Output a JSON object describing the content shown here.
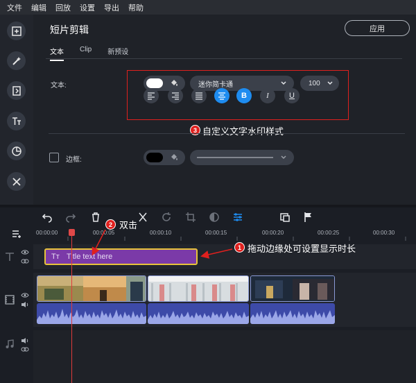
{
  "menu": [
    "文件",
    "编辑",
    "回放",
    "设置",
    "导出",
    "帮助"
  ],
  "rail_icons": [
    "import-icon",
    "magic-wand-icon",
    "transition-icon",
    "titles-icon",
    "stickers-icon",
    "tools-icon"
  ],
  "panel": {
    "title": "短片剪辑",
    "apply_label": "应用",
    "tabs": [
      "文本",
      "Clip",
      "新预设"
    ],
    "active_tab": "文本"
  },
  "text_settings": {
    "label": "文本:",
    "font": "迷你简卡通",
    "size": "100",
    "text_color": "#ffffff"
  },
  "border_settings": {
    "label": "边框:",
    "color": "#000000",
    "checked": false
  },
  "annotations": {
    "step1_number": "1",
    "step1_text": "拖动边缘处可设置显示时长",
    "step2_number": "2",
    "step2_text": "双击",
    "step3_number": "3",
    "step3_text": "自定义文字水印样式",
    "color": "#e0201e"
  },
  "timeline": {
    "ruler": [
      "00:00:00",
      "00:00:05",
      "00:00:10",
      "00:00:15",
      "00:00:20",
      "00:00:25",
      "00:00:30"
    ],
    "title_clip": "Title text here"
  },
  "colors": {
    "accent": "#1e8cf0",
    "title_clip": "#7b3aa8",
    "playhead": "#e03b3b"
  }
}
